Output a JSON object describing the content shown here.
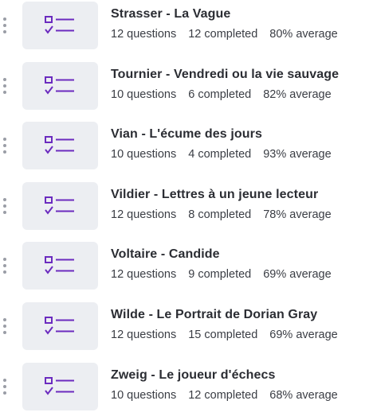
{
  "colors": {
    "icon": "#6b2bbf",
    "thumb_bg": "#eceef2",
    "title": "#2b2d33",
    "stats": "#3a3d44"
  },
  "quizzes": [
    {
      "title": "Strasser - La Vague",
      "questions": "12 questions",
      "completed": "12 completed",
      "average": "80% average"
    },
    {
      "title": "Tournier - Vendredi ou la vie sauvage",
      "questions": "10 questions",
      "completed": "6 completed",
      "average": "82% average"
    },
    {
      "title": "Vian - L'écume des jours",
      "questions": "10 questions",
      "completed": "4 completed",
      "average": "93% average"
    },
    {
      "title": "Vildier - Lettres à un jeune lecteur",
      "questions": "12 questions",
      "completed": "8 completed",
      "average": "78% average"
    },
    {
      "title": "Voltaire - Candide",
      "questions": "12 questions",
      "completed": "9 completed",
      "average": "69% average"
    },
    {
      "title": "Wilde - Le Portrait de Dorian Gray",
      "questions": "12 questions",
      "completed": "15 completed",
      "average": "69% average"
    },
    {
      "title": "Zweig - Le joueur d'échecs",
      "questions": "10 questions",
      "completed": "12 completed",
      "average": "68% average"
    }
  ]
}
